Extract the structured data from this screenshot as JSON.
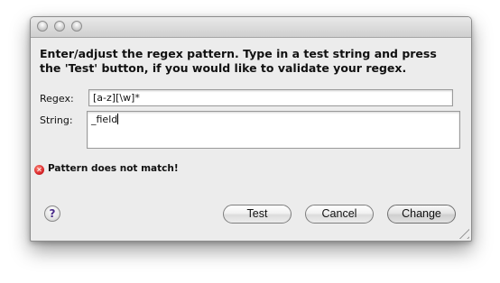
{
  "instructions": "Enter/adjust the regex pattern. Type in a test string and press the 'Test' button, if you would like to validate your regex.",
  "regex": {
    "label": "Regex:",
    "value": "[a-z][\\w]*"
  },
  "string": {
    "label": "String:",
    "value": "_field"
  },
  "status": {
    "icon": "error-icon",
    "text": "Pattern does not match!"
  },
  "help": {
    "glyph": "?"
  },
  "buttons": {
    "test": "Test",
    "cancel": "Cancel",
    "change": "Change"
  }
}
